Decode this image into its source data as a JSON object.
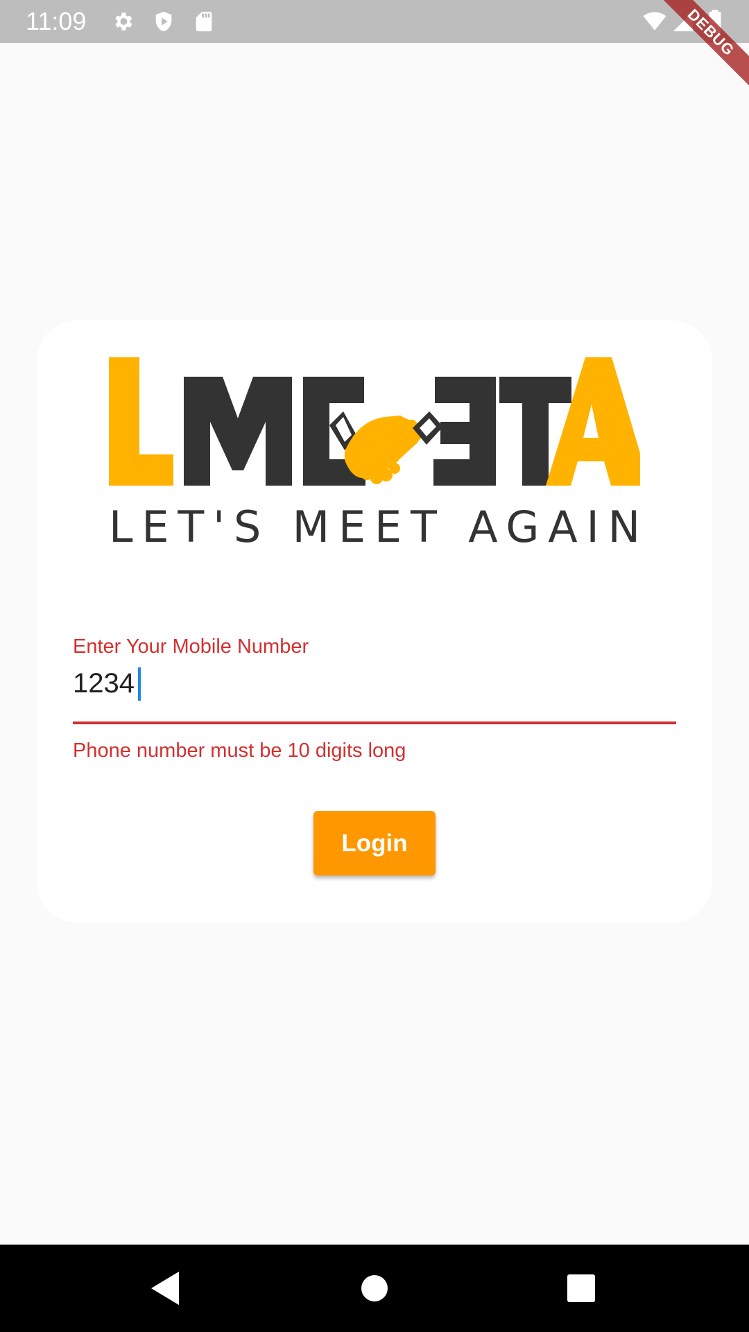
{
  "status_bar": {
    "time": "11:09",
    "icons": [
      "settings-icon",
      "shield-play-icon",
      "sd-card-icon",
      "wifi-icon",
      "signal-icon",
      "battery-icon"
    ]
  },
  "debug_banner": {
    "label": "DEBUG"
  },
  "logo": {
    "wordmark": "LMEETA",
    "tagline": "LET'S MEET AGAIN",
    "colors": {
      "accent": "#ffb300",
      "dark": "#333333"
    }
  },
  "login_form": {
    "mobile_label": "Enter Your Mobile Number",
    "mobile_value": "1234",
    "error_message": "Phone number must be 10 digits long",
    "login_label": "Login"
  },
  "nav_bar": {
    "buttons": [
      "back-icon",
      "home-icon",
      "recents-icon"
    ]
  },
  "colors": {
    "error": "#d32f2f",
    "button": "#ff9800",
    "caret": "#1e88e5",
    "status_bar": "#bdbdbd"
  }
}
